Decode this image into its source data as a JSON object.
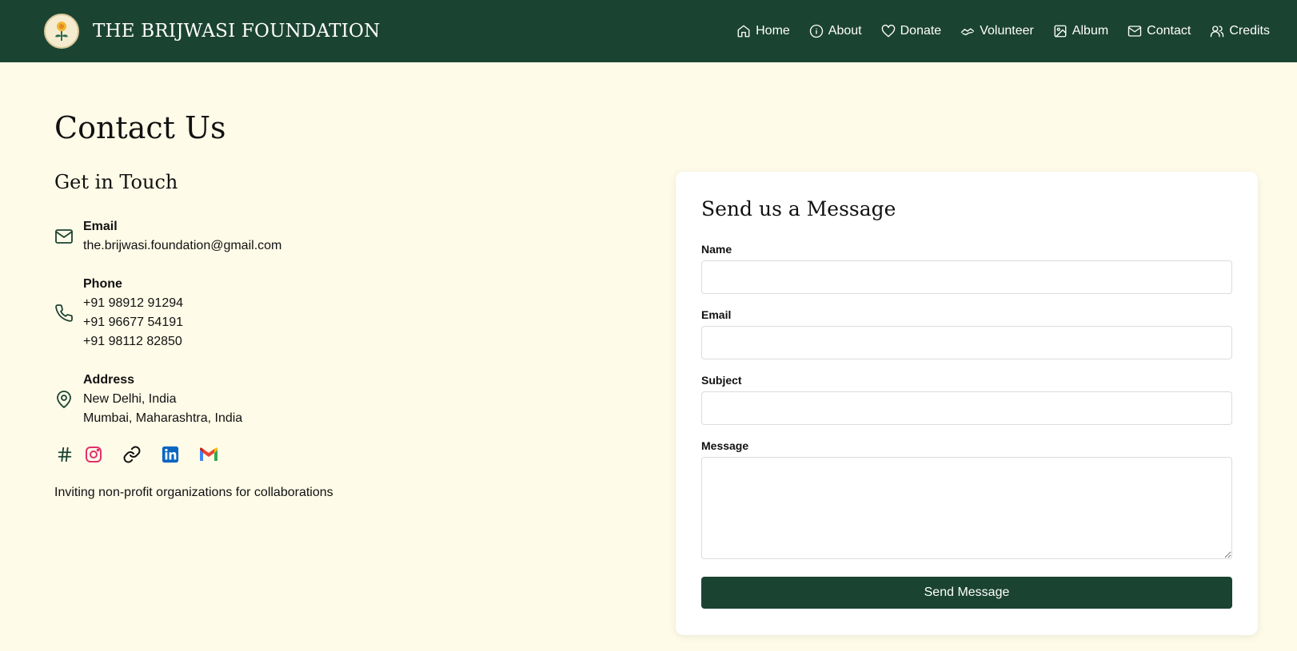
{
  "header": {
    "brand_name": "THE BRIJWASI FOUNDATION",
    "nav": [
      {
        "label": "Home",
        "icon": "home-icon"
      },
      {
        "label": "About",
        "icon": "info-icon"
      },
      {
        "label": "Donate",
        "icon": "heart-icon"
      },
      {
        "label": "Volunteer",
        "icon": "handshake-icon"
      },
      {
        "label": "Album",
        "icon": "image-icon"
      },
      {
        "label": "Contact",
        "icon": "mail-icon"
      },
      {
        "label": "Credits",
        "icon": "users-icon"
      }
    ]
  },
  "main": {
    "page_title": "Contact Us",
    "section_title": "Get in Touch",
    "email": {
      "label": "Email",
      "value": "the.brijwasi.foundation@gmail.com"
    },
    "phone": {
      "label": "Phone",
      "values": [
        "+91 98912 91294",
        "+91 96677 54191",
        "+91 98112 82850"
      ]
    },
    "address": {
      "label": "Address",
      "values": [
        "New Delhi, India",
        "Mumbai, Maharashtra, India"
      ]
    },
    "socials": [
      "hashtag-icon",
      "instagram-icon",
      "link-icon",
      "linkedin-icon",
      "gmail-icon"
    ],
    "tagline": "Inviting non-profit organizations for collaborations"
  },
  "form": {
    "title": "Send us a Message",
    "name_label": "Name",
    "email_label": "Email",
    "subject_label": "Subject",
    "message_label": "Message",
    "submit_label": "Send Message"
  },
  "colors": {
    "primary": "#1b4332",
    "background": "#fefbe8",
    "instagram": "#e1306c",
    "linkedin": "#0a66c2"
  }
}
